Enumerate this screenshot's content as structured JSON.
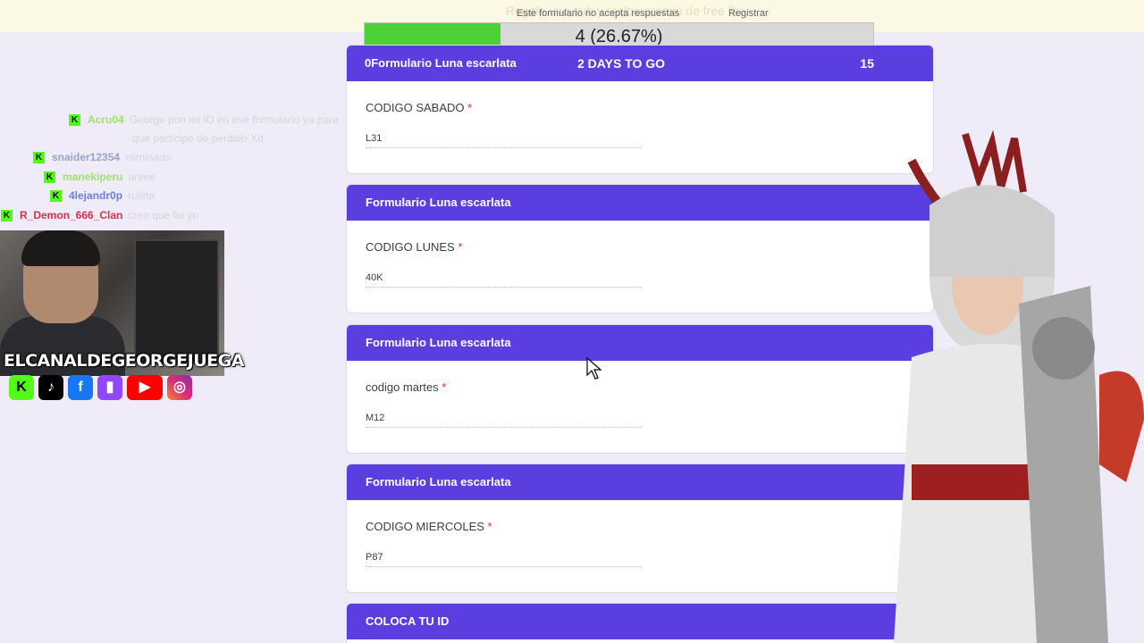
{
  "banner": {
    "overlay_text": "Regala una sub y recibe premio de free fire",
    "form_notice": "Este formulario no acepta respuestas",
    "right_text": "Registrar"
  },
  "progress": {
    "label": "4 (26.67%)",
    "fraction": 0.2667
  },
  "cards": [
    {
      "header": "Formulario  Luna escarlata",
      "header_prefix": "0",
      "countdown": "2 DAYS TO GO",
      "count": "15",
      "question": "CODIGO SABADO",
      "required": "*",
      "answer": "L31"
    },
    {
      "header": "Formulario  Luna escarlata",
      "question": "CODIGO LUNES",
      "required": "*",
      "answer": "40K"
    },
    {
      "header": "Formulario  Luna escarlata",
      "question": "codigo martes",
      "required": "*",
      "answer": "M12"
    },
    {
      "header": "Formulario  Luna escarlata",
      "question": "CODIGO MIERCOLES",
      "required": "*",
      "answer": "P87"
    },
    {
      "header": "COLOCA TU ID"
    }
  ],
  "chat": [
    {
      "user": "Acru04",
      "message": "George pon mi ID en ese formulario ya para",
      "message2": "que participe de perdido Xd",
      "color": "#9be36b"
    },
    {
      "user": "snaider12354",
      "message": "eliminado",
      "color": "#9aa3c8"
    },
    {
      "user": "manekiperu",
      "message": "areee",
      "color": "#9be36b"
    },
    {
      "user": "4lejandr0p",
      "message": "ruleta",
      "color": "#6b7fd9"
    },
    {
      "user": "R_Demon_666_Clan",
      "message": "creo que fui yo",
      "color": "#d8304a"
    }
  ],
  "kick_badge": "K",
  "stream": {
    "channel": "ELCANALDEGEORGEJUEGA",
    "socials": [
      "kick-icon",
      "tiktok-icon",
      "facebook-icon",
      "twitch-icon",
      "youtube-icon",
      "instagram-icon"
    ]
  },
  "colors": {
    "form_header": "#5a3ee0",
    "progress_fill": "#4cd137",
    "required": "#d93025"
  }
}
